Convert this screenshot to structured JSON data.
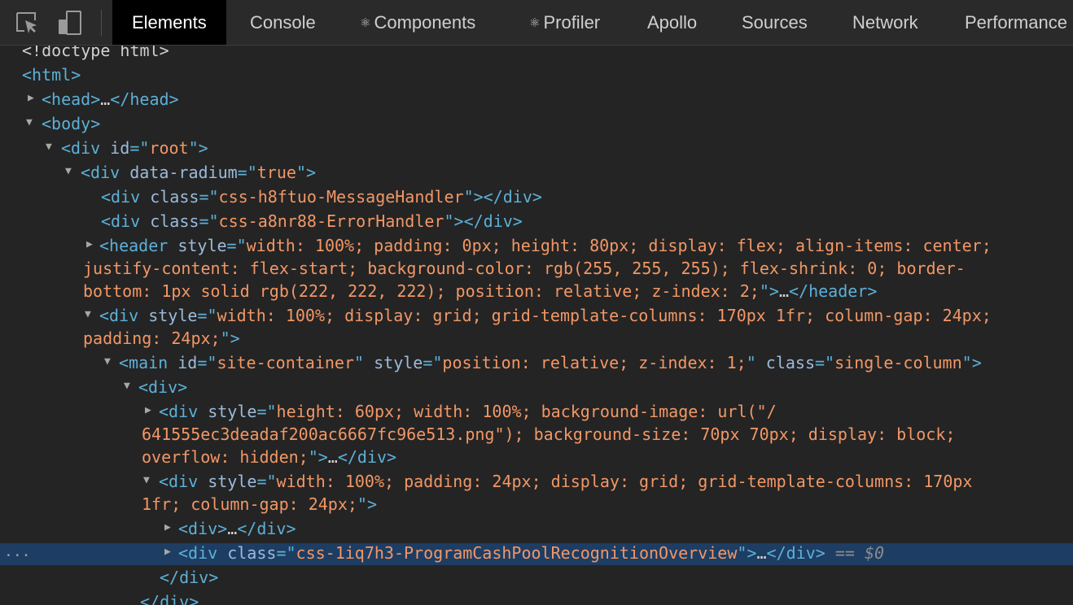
{
  "toolbar": {
    "tabs": [
      {
        "label": "Elements",
        "glyph": ""
      },
      {
        "label": "Console",
        "glyph": ""
      },
      {
        "label": "Components",
        "glyph": "⚛"
      },
      {
        "label": "Profiler",
        "glyph": "⚛"
      },
      {
        "label": "Apollo",
        "glyph": ""
      },
      {
        "label": "Sources",
        "glyph": ""
      },
      {
        "label": "Network",
        "glyph": ""
      },
      {
        "label": "Performance",
        "glyph": ""
      }
    ],
    "active_tab": "Elements",
    "icons": [
      "element-picker-icon",
      "device-toolbar-icon"
    ]
  },
  "tree": {
    "doctype": "<!doctype html>",
    "html_open": "<html>",
    "head": {
      "open": "<head>",
      "ellipsis": "…",
      "close": "</head>"
    },
    "body_open": "<body>",
    "root": {
      "open": "<div ",
      "attr": "id",
      "eq": "=\"",
      "val": "root",
      "close": "\">"
    },
    "radium": {
      "open": "<div ",
      "attr": "data-radium",
      "eq": "=\"",
      "val": "true",
      "close": "\">"
    },
    "msg_handler": {
      "open": "<div ",
      "attr": "class",
      "eq": "=\"",
      "val": "css-h8ftuo-MessageHandler",
      "close": "\">",
      "end": "</div>"
    },
    "err_handler": {
      "open": "<div ",
      "attr": "class",
      "eq": "=\"",
      "val": "css-a8nr88-ErrorHandler",
      "close": "\">",
      "end": "</div>"
    },
    "header": {
      "open": "<header ",
      "attr": "style",
      "eq": "=\"",
      "val1": "width: 100%; padding: 0px; height: 80px; display: flex; align-items: center;",
      "val2": "justify-content: flex-start; background-color: rgb(255, 255, 255); flex-shrink: 0; border-",
      "val3": "bottom: 1px solid rgb(222, 222, 222); position: relative; z-index: 2;",
      "close": "\">",
      "ellipsis": "…",
      "end": "</header>"
    },
    "grid_div": {
      "open": "<div ",
      "attr": "style",
      "eq": "=\"",
      "val1": "width: 100%; display: grid; grid-template-columns: 170px 1fr; column-gap: 24px;",
      "val2": "padding: 24px;",
      "close": "\">"
    },
    "main": {
      "open": "<main ",
      "attr_id": "id",
      "eq": "=\"",
      "val_id": "site-container",
      "q": "\" ",
      "attr_style": "style",
      "val_style": "position: relative; z-index: 1;",
      "attr_class": "class",
      "val_class": "single-column",
      "close": "\">"
    },
    "div_plain": "<div>",
    "bg_div": {
      "open": "<div ",
      "attr": "style",
      "eq": "=\"",
      "val1": "height: 60px; width: 100%; background-image: url(\"/",
      "val2": "641555ec3deadaf200ac6667fc96e513.png\"); background-size: 70px 70px; display: block;",
      "val3": "overflow: hidden;",
      "close": "\">",
      "ellipsis": "…",
      "end": "</div>"
    },
    "inner_grid": {
      "open": "<div ",
      "attr": "style",
      "eq": "=\"",
      "val1": "width: 100%; padding: 24px; display: grid; grid-template-columns: 170px",
      "val2": "1fr; column-gap: 24px;",
      "close": "\">"
    },
    "collapsed_div": {
      "open": "<div>",
      "ellipsis": "…",
      "end": "</div>"
    },
    "selected": {
      "open": "<div ",
      "attr": "class",
      "eq": "=\"",
      "val": "css-1iq7h3-ProgramCashPoolRecognitionOverview",
      "close": "\">",
      "ellipsis": "…",
      "end": "</div>",
      "marker": " == ",
      "dollar": "$0",
      "row_dots": "..."
    },
    "close_div": "</div>"
  }
}
